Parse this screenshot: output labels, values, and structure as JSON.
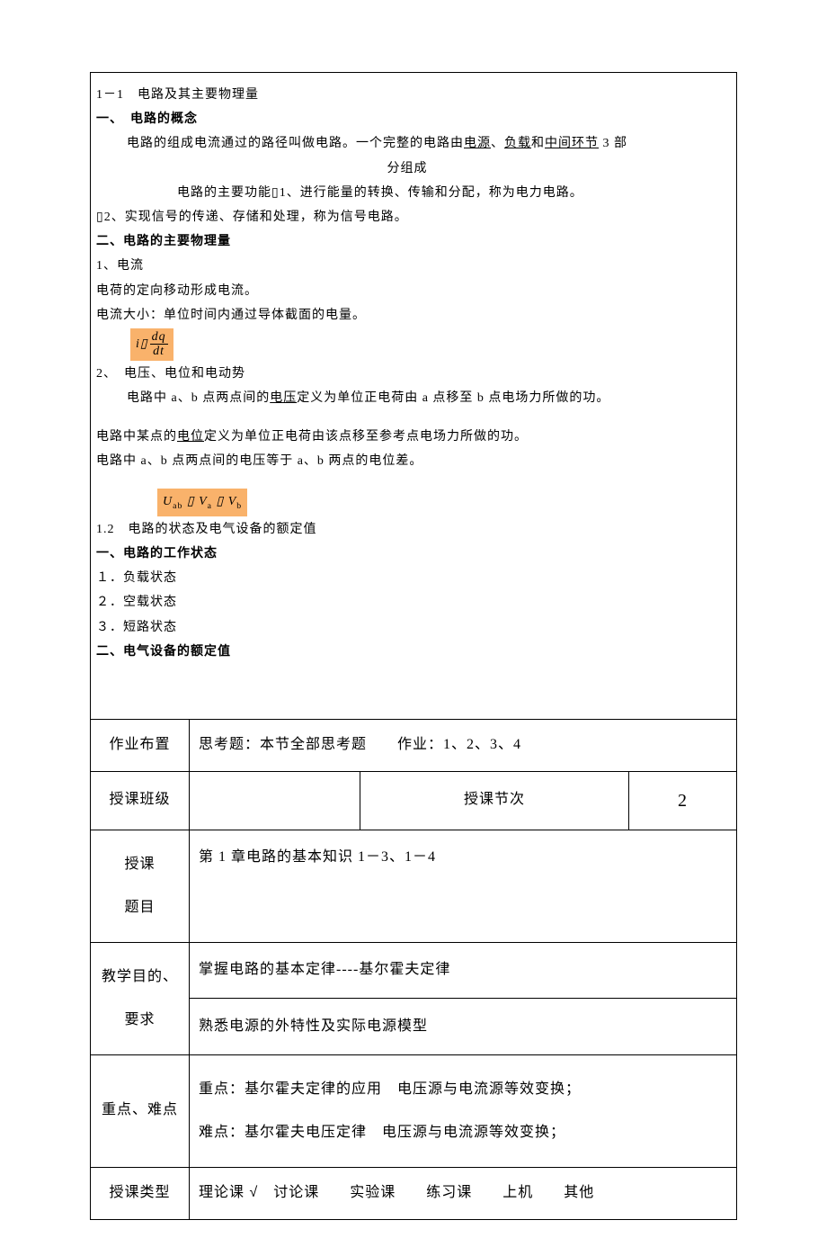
{
  "content": {
    "l1": "1－1　电路及其主要物理量",
    "l2": "一、　电路的概念",
    "l3a": "电路的组成电流通过的路径叫做电路。一个完整的电路由",
    "l3_src": "电源",
    "l3_sep1": "、",
    "l3_load": "负载",
    "l3_sep2": "和",
    "l3_mid": "中间环节",
    "l3b": " 3 部",
    "l4": "分组成",
    "l5": "电路的主要功能▯1、进行能量的转换、传输和分配，称为电力电路。",
    "l6": "▯2、实现信号的传递、存储和处理，称为信号电路。",
    "l7": "二、电路的主要物理量",
    "l8": "1、电流",
    "l9": "电荷的定向移动形成电流。",
    "l10": "电流大小：单位时间内通过导体截面的电量。",
    "f1_lhs": "i▯",
    "f1_num": "dq",
    "f1_den": "dt",
    "l11": "2、　电压、电位和电动势",
    "l12a": "电路中 a、b 点两点间的",
    "l12_u": "电压",
    "l12b": "定义为单位正电荷由 a 点移至 b 点电场力所做的功。",
    "l13a": "电路中某点的",
    "l13_u": "电位",
    "l13b": "定义为单位正电荷由该点移至参考点电场力所做的功。",
    "l14": "电路中 a、b 点两点间的电压等于 a、b 两点的电位差。",
    "f2": "Uab ▯ Va ▯ Vb",
    "l15": "1.2　电路的状态及电气设备的额定值",
    "l16": "一、电路的工作状态",
    "l17": "１．负载状态",
    "l18": "２．空载状态",
    "l19": "３．短路状态",
    "l20": "二、电气设备的额定值"
  },
  "table": {
    "hw_label": "作业布置",
    "hw_value": "思考题：本节全部思考题　　作业：1、2、3、4",
    "class_label": "授课班级",
    "class_value": "",
    "session_label": "授课节次",
    "session_value": "2",
    "topic_label_1": "授课",
    "topic_label_2": "题目",
    "topic_value": "第 1 章电路的基本知识 1－3、1－4",
    "goal_label_1": "教学目的、",
    "goal_label_2": "要求",
    "goal_value_1": "掌握电路的基本定律----基尔霍夫定律",
    "goal_value_2": "熟悉电源的外特性及实际电源模型",
    "keypoint_label": "重点、难点",
    "keypoint_value_1": "重点：基尔霍夫定律的应用　电压源与电流源等效变换；",
    "keypoint_value_2": "难点：基尔霍夫电压定律　电压源与电流源等效变换；",
    "type_label": "授课类型",
    "type_value": "理论课 √　讨论课　　实验课　　练习课　　上机　　其他"
  }
}
